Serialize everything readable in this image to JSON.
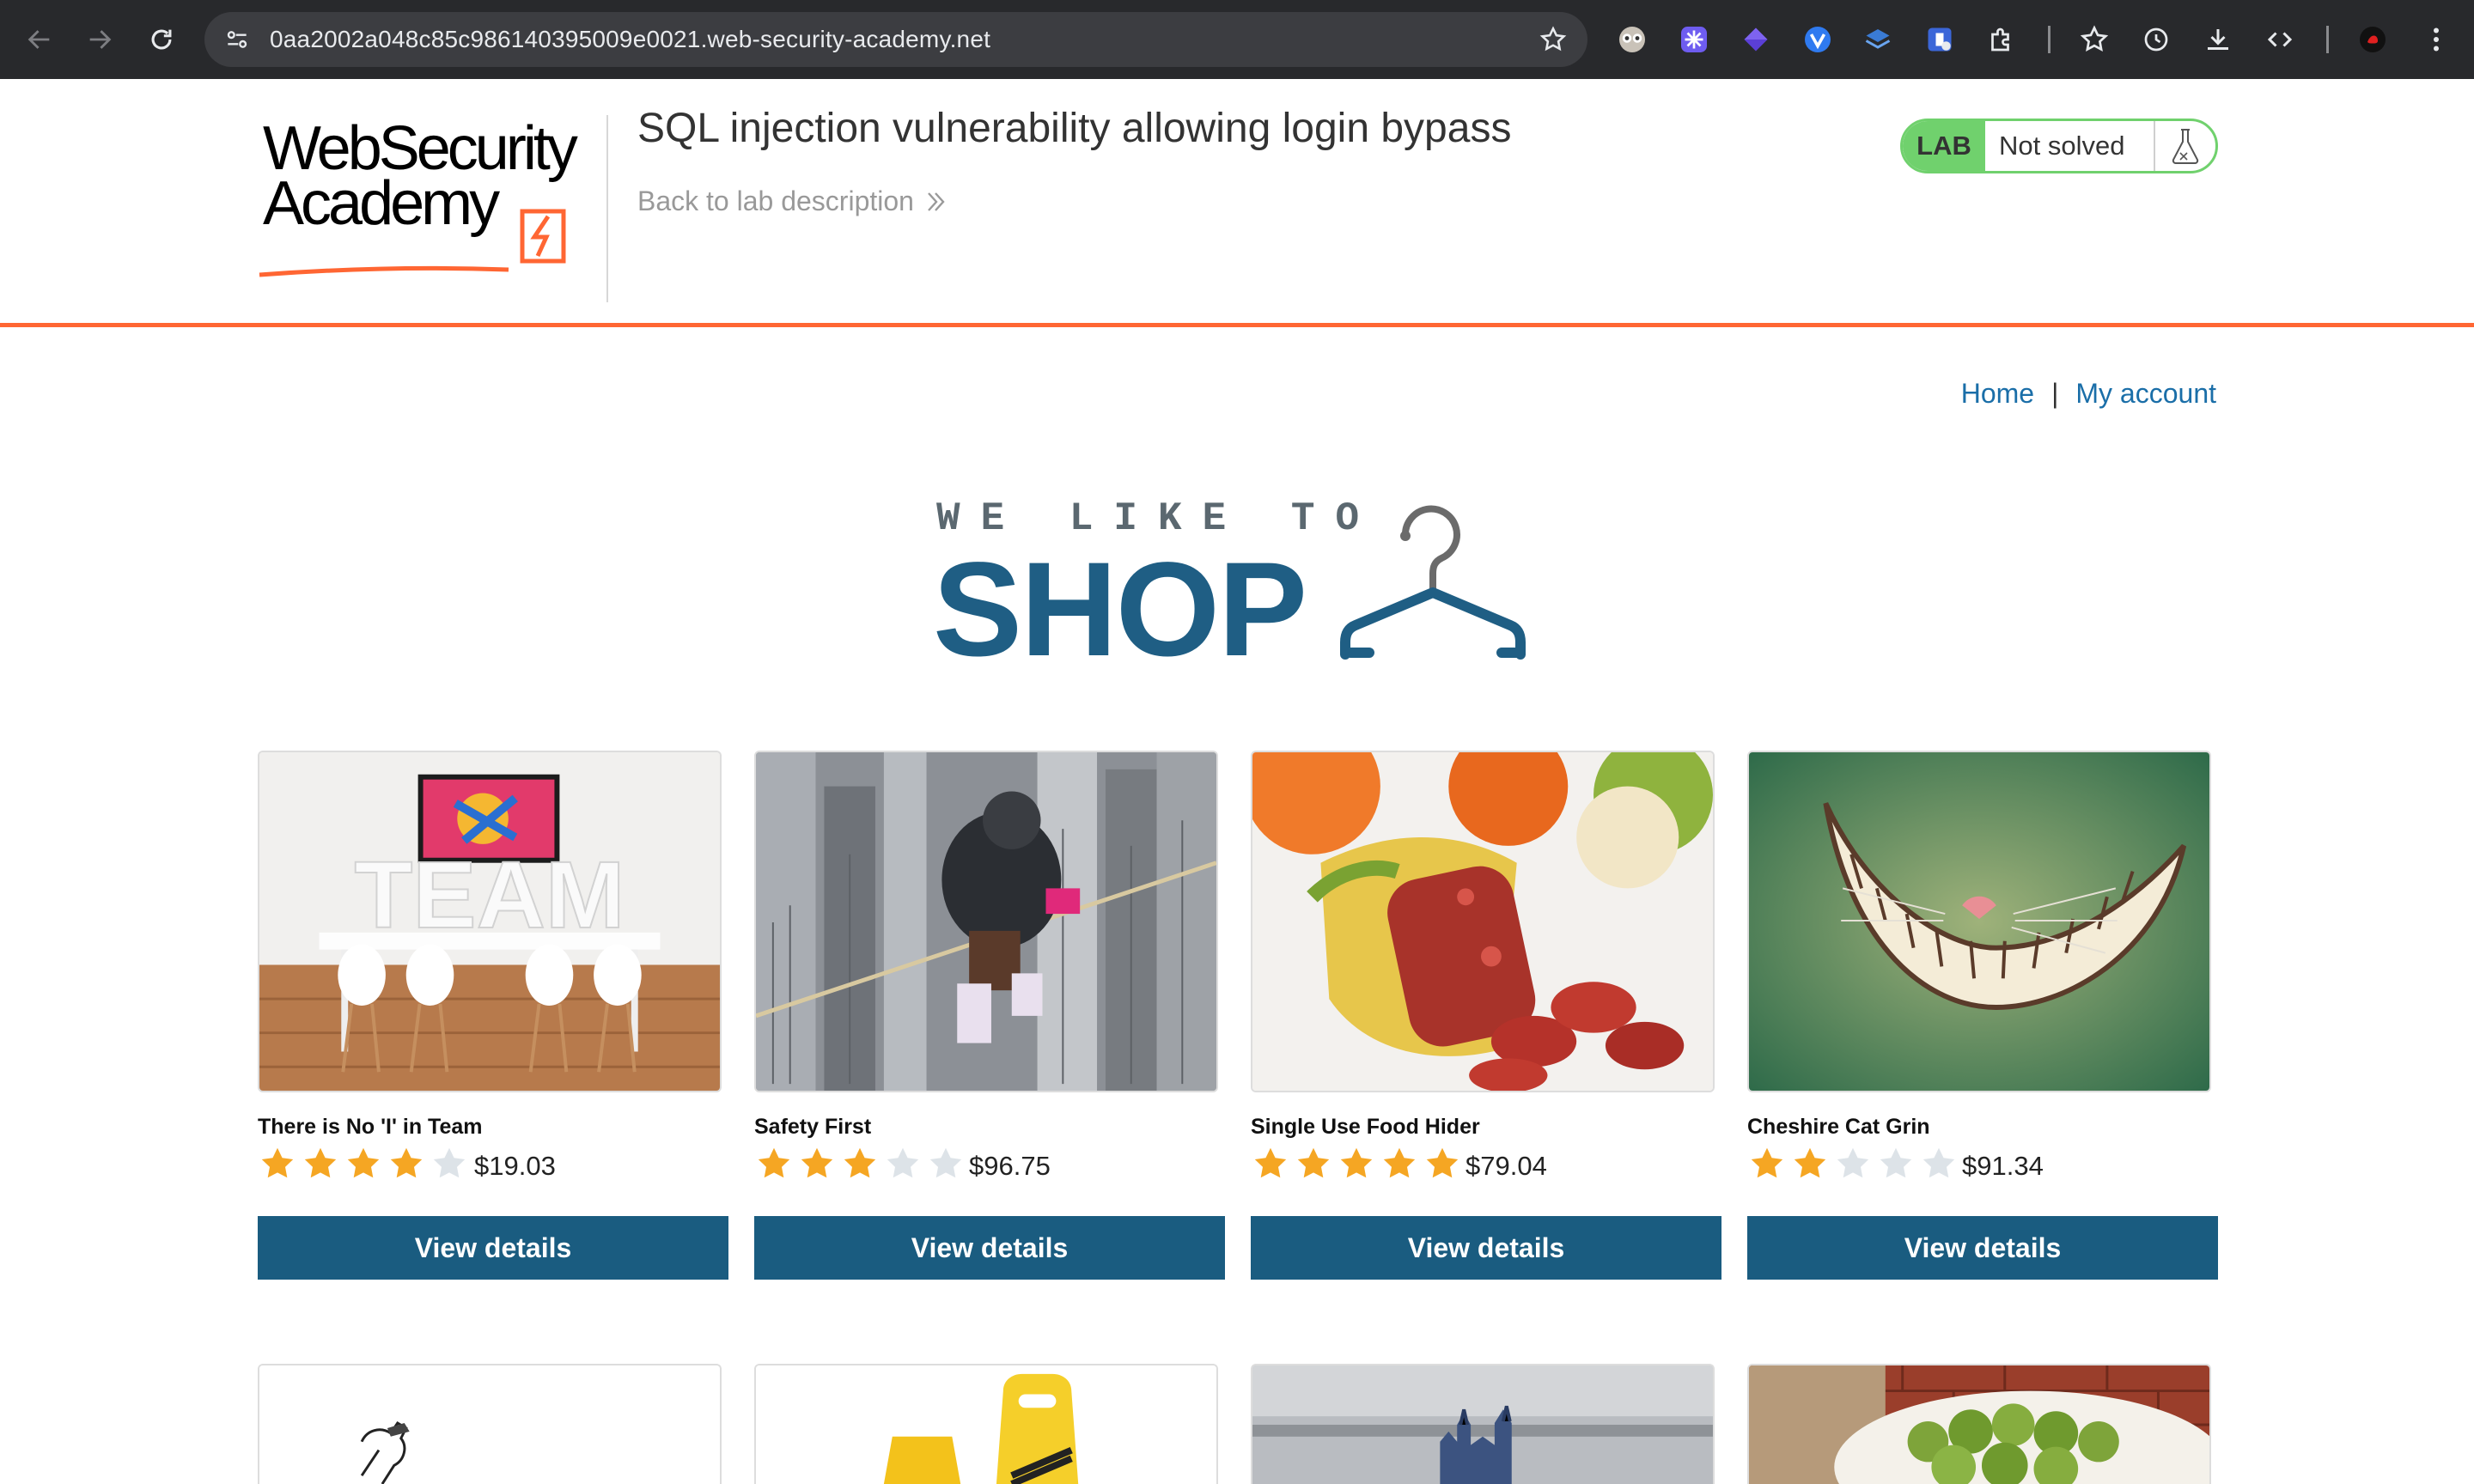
{
  "browser": {
    "url": "0aa2002a048c85c986140395009e0021.web-security-academy.net"
  },
  "header": {
    "logo_line1": "WebSecurity",
    "logo_line2": "Academy",
    "lab_title": "SQL injection vulnerability allowing login bypass",
    "back_link": "Back to lab description",
    "lab_badge_label": "LAB",
    "lab_status": "Not solved"
  },
  "nav": {
    "home": "Home",
    "separator": "|",
    "my_account": "My account"
  },
  "banner": {
    "small_text": "WE LIKE TO",
    "big_text": "SHOP"
  },
  "products": [
    {
      "name": "There is No 'I' in Team",
      "rating": 4,
      "price": "$19.03",
      "button": "View details"
    },
    {
      "name": "Safety First",
      "rating": 3,
      "price": "$96.75",
      "button": "View details"
    },
    {
      "name": "Single Use Food Hider",
      "rating": 5,
      "price": "$79.04",
      "button": "View details"
    },
    {
      "name": "Cheshire Cat Grin",
      "rating": 2,
      "price": "$91.34",
      "button": "View details"
    }
  ],
  "colors": {
    "accent_orange": "#ff6633",
    "button_blue": "#1a5c80",
    "link_blue": "#1a6ea8",
    "lab_green": "#70d16d",
    "star_filled": "#f5a623",
    "star_empty": "#dde3e8"
  }
}
